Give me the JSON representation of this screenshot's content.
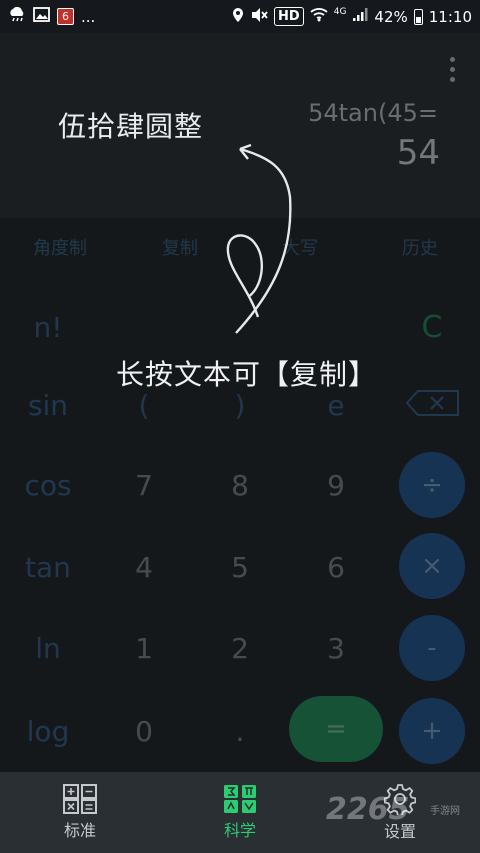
{
  "status_bar": {
    "badge_number": "6",
    "ellipsis": "...",
    "hd": "HD",
    "network": "4G",
    "battery": "42%",
    "time": "11:10"
  },
  "display": {
    "capitalized_result": "伍拾肆圆整",
    "expression": "54tan(45=",
    "result": "54"
  },
  "hint": {
    "text": "长按文本可【复制】"
  },
  "functions": {
    "angle_mode": "角度制",
    "copy": "复制",
    "uppercase": "大写",
    "history": "历史"
  },
  "keys": {
    "factorial": "n!",
    "clear": "C",
    "sin": "sin",
    "open_paren": "(",
    "close_paren": ")",
    "e": "e",
    "cos": "cos",
    "seven": "7",
    "eight": "8",
    "nine": "9",
    "divide": "÷",
    "tan": "tan",
    "four": "4",
    "five": "5",
    "six": "6",
    "multiply": "×",
    "ln": "ln",
    "one": "1",
    "two": "2",
    "three": "3",
    "minus": "-",
    "log": "log",
    "zero": "0",
    "dot": ".",
    "equals": "=",
    "plus": "+"
  },
  "bottom_nav": {
    "standard": "标准",
    "scientific": "科学",
    "settings": "设置",
    "active": "scientific"
  },
  "watermark": {
    "text": "2265",
    "sub": "手游网"
  },
  "colors": {
    "accent_green": "#2ecc71",
    "operator_blue": "#1e4470",
    "equals_green": "#1d6e48"
  }
}
